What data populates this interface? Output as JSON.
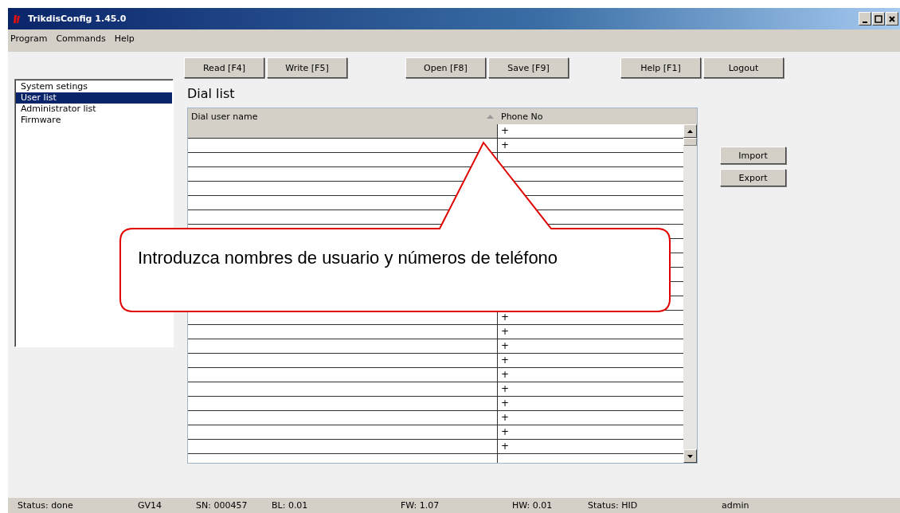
{
  "window": {
    "title": "TrikdisConfig 1.45.0"
  },
  "menu": [
    "Program",
    "Commands",
    "Help"
  ],
  "toolbar": [
    "Read [F4]",
    "Write [F5]",
    "Open [F8]",
    "Save [F9]",
    "Help [F1]",
    "Logout"
  ],
  "sidebar": {
    "items": [
      {
        "label": "System setings",
        "selected": false
      },
      {
        "label": "User list",
        "selected": true
      },
      {
        "label": "Administrator list",
        "selected": false
      },
      {
        "label": "Firmware",
        "selected": false
      }
    ]
  },
  "page_title": "Dial list",
  "table": {
    "columns": [
      "Dial user name",
      "Phone No"
    ],
    "rows": [
      {
        "selected": true,
        "phone": "+"
      },
      {
        "phone": "+"
      },
      {},
      {},
      {},
      {},
      {},
      {},
      {},
      {},
      {},
      {},
      {},
      {
        "phone": "+"
      },
      {
        "phone": "+"
      },
      {
        "phone": "+"
      },
      {
        "phone": "+"
      },
      {
        "phone": "+"
      },
      {
        "phone": "+"
      },
      {
        "phone": "+"
      },
      {
        "phone": "+"
      },
      {
        "phone": "+"
      },
      {
        "phone": "+"
      },
      {}
    ]
  },
  "side_buttons": [
    "Import",
    "Export"
  ],
  "callout": {
    "text": "Introduzca nombres de usuario y números de teléfono"
  },
  "status_bar": [
    "Status: done",
    "GV14",
    "SN: 000457",
    "BL: 0.01",
    "FW: 1.07",
    "HW: 0.01",
    "Status: HID",
    "admin"
  ]
}
